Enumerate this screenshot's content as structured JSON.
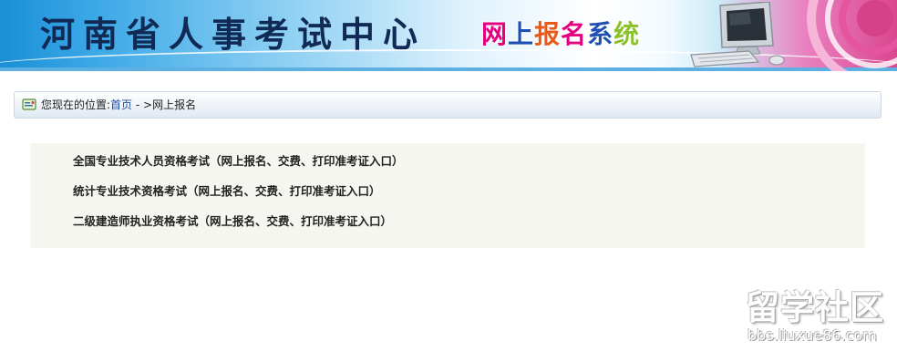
{
  "header": {
    "site_title": "河南省人事考试中心",
    "system_title_chars": [
      "网",
      "上",
      "报",
      "名",
      "系",
      "统"
    ]
  },
  "breadcrumb": {
    "prefix": "您现在的位置:",
    "home_link": "首页",
    "separator": " - >",
    "current": "网上报名"
  },
  "exams": [
    {
      "label": "全国专业技术人员资格考试（网上报名、交费、打印准考证入口）"
    },
    {
      "label": "统计专业技术资格考试（网上报名、交费、打印准考证入口）"
    },
    {
      "label": "二级建造师执业资格考试（网上报名、交费、打印准考证入口）"
    }
  ],
  "watermark": {
    "brand": "留学社区",
    "url": "bbs.liuxue86.com"
  },
  "colors": {
    "header_blue": "#1a8fd6",
    "link_blue": "#1f4fa3",
    "panel_bg": "#f6f6f1",
    "accent_pink": "#e4007f"
  },
  "icons": {
    "breadcrumb": "location-card-icon",
    "header_art": "computer-icon"
  }
}
